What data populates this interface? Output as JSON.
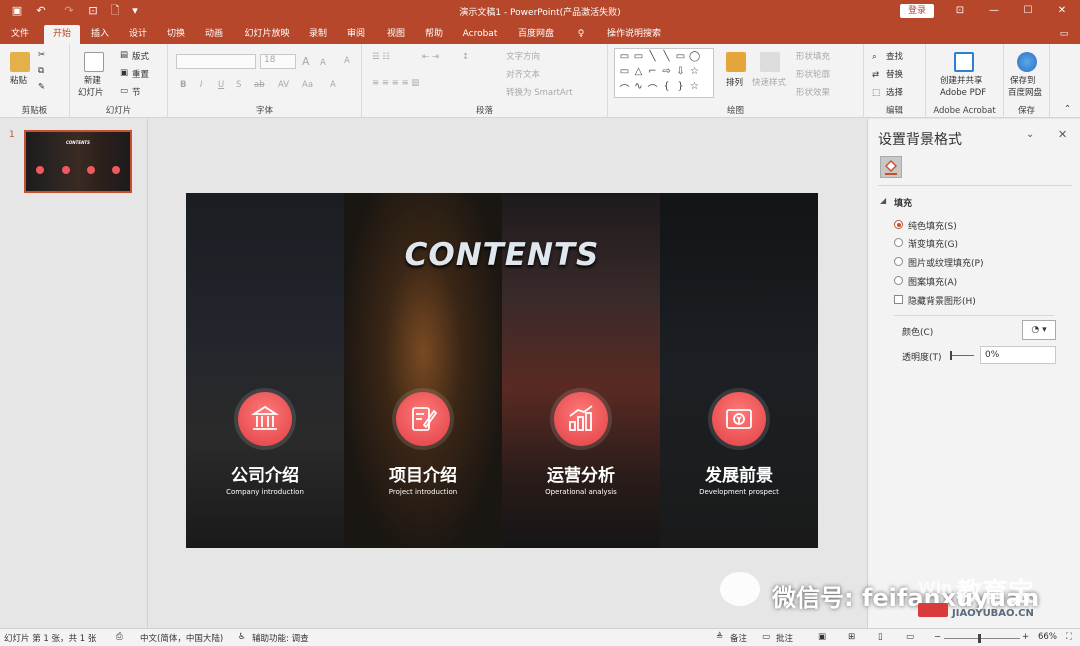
{
  "window": {
    "title": "演示文稿1 - PowerPoint(产品激活失败)",
    "login": "登录",
    "min": "—",
    "max": "☐",
    "close": "✕"
  },
  "qat": {
    "save": "▣",
    "undo": "↶",
    "redo": "↷",
    "start": "⊡",
    "new": "🗋",
    "more": "▾"
  },
  "tabs": [
    "文件",
    "开始",
    "插入",
    "设计",
    "切换",
    "动画",
    "幻灯片放映",
    "录制",
    "审阅",
    "视图",
    "帮助",
    "Acrobat",
    "百度网盘",
    "操作说明搜索"
  ],
  "ribbon": {
    "clipboard": {
      "paste": "粘贴",
      "label": "剪贴板"
    },
    "slides": {
      "new_slide": "新建",
      "new_slide2": "幻灯片",
      "layout": "版式",
      "reset": "重置",
      "section": "节",
      "label": "幻灯片"
    },
    "font": {
      "size": "18",
      "label": "字体",
      "bold": "B",
      "italic": "I",
      "underline": "U",
      "strike": "S",
      "shadow": "ab",
      "spacing": "AV",
      "case": "Aa",
      "color": "A",
      "grow": "A",
      "shrink": "A",
      "clear": "A"
    },
    "paragraph": {
      "text_dir": "文字方向",
      "align_text": "对齐文本",
      "smartart": "转换为 SmartArt",
      "label": "段落"
    },
    "drawing": {
      "arrange": "排列",
      "quick_styles": "快速样式",
      "fill": "形状填充",
      "outline": "形状轮廓",
      "effects": "形状效果",
      "label": "绘图"
    },
    "editing": {
      "find": "查找",
      "replace": "替换",
      "select": "选择",
      "label": "编辑"
    },
    "acrobat": {
      "create": "创建并共享",
      "create2": "Adobe PDF",
      "label": "Adobe Acrobat"
    },
    "save": {
      "save1": "保存到",
      "save2": "百度网盘",
      "label": "保存"
    }
  },
  "thumb": {
    "number": "1",
    "title": "CONTENTS"
  },
  "slide": {
    "title": "CONTENTS",
    "sections": [
      {
        "title": "公司介绍",
        "subtitle": "Company introduction",
        "icon": "bank-icon"
      },
      {
        "title": "项目介绍",
        "subtitle": "Project introduction",
        "icon": "document-edit-icon"
      },
      {
        "title": "运营分析",
        "subtitle": "Operational analysis",
        "icon": "bar-chart-icon"
      },
      {
        "title": "发展前景",
        "subtitle": "Development prospect",
        "icon": "money-icon"
      }
    ]
  },
  "format_pane": {
    "title": "设置背景格式",
    "fill_header": "填充",
    "options": [
      "纯色填充(S)",
      "渐变填充(G)",
      "图片或纹理填充(P)",
      "图案填充(A)"
    ],
    "selected": 0,
    "hide_bg": "隐藏背景图形(H)",
    "color_label": "颜色(C)",
    "transparency_label": "透明度(T)",
    "transparency_value": "0%"
  },
  "status": {
    "slide_info": "幻灯片 第 1 张，共 1 张",
    "language": "中文(简体，中国大陆)",
    "accessibility": "辅助功能: 调查",
    "notes": "备注",
    "comments": "批注",
    "zoom": "66%",
    "plus": "+",
    "minus": "−"
  },
  "watermark": {
    "wechat": "微信号: feifanxuyuan",
    "site": "教育宝",
    "site_url": "JIAOYUBAO.CN",
    "win": "Win"
  },
  "colors": {
    "accent": "#b7472a",
    "circle": "#f05a5e"
  }
}
